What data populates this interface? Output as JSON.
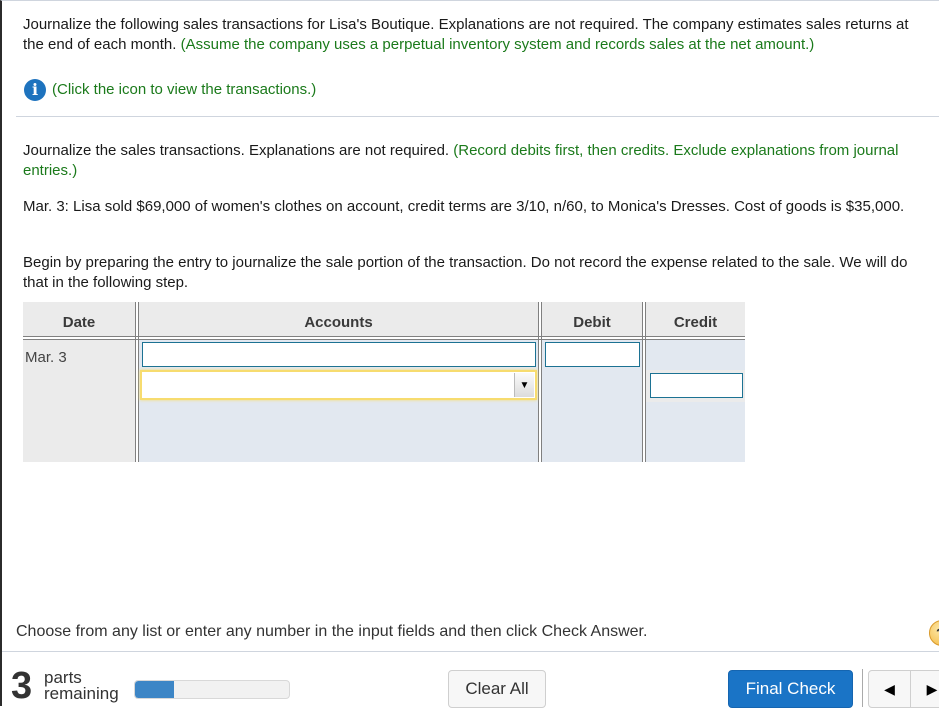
{
  "problem": {
    "intro_black": "Journalize the following sales transactions for Lisa's Boutique. Explanations are not required. The company estimates sales returns at the end of each month.",
    "intro_green": "(Assume the company uses a perpetual inventory system and records sales at the net amount.)",
    "info_icon": "info-icon",
    "info_link": "(Click the icon to view the transactions.)"
  },
  "part": {
    "instr_black": "Journalize the sales transactions. Explanations are not required.",
    "instr_green": "(Record debits first, then credits. Exclude explanations from journal entries.)",
    "transaction": "Mar. 3: Lisa sold $69,000 of women's clothes on account, credit terms are 3/10, n/60, to Monica's Dresses. Cost of goods is $35,000.",
    "begin": "Begin by preparing the entry to journalize the sale portion of the transaction. Do not record the expense related to the sale. We will do that in the following step."
  },
  "journal": {
    "headers": {
      "date": "Date",
      "accounts": "Accounts",
      "debit": "Debit",
      "credit": "Credit"
    },
    "rows": [
      {
        "date": "Mar. 3",
        "account": "",
        "debit": "",
        "credit": ""
      },
      {
        "date": "",
        "account": "",
        "debit": "",
        "credit": ""
      }
    ],
    "dropdown_icon": "▼"
  },
  "footer": {
    "choose_text": "Choose from any list or enter any number in the input fields and then click Check Answer.",
    "help_icon": "?",
    "parts_count": "3",
    "parts_label_1": "parts",
    "parts_label_2": "remaining",
    "progress_fraction": 0.25,
    "clear_all": "Clear All",
    "final_check": "Final Check",
    "prev_icon": "◀",
    "next_icon": "▶"
  }
}
